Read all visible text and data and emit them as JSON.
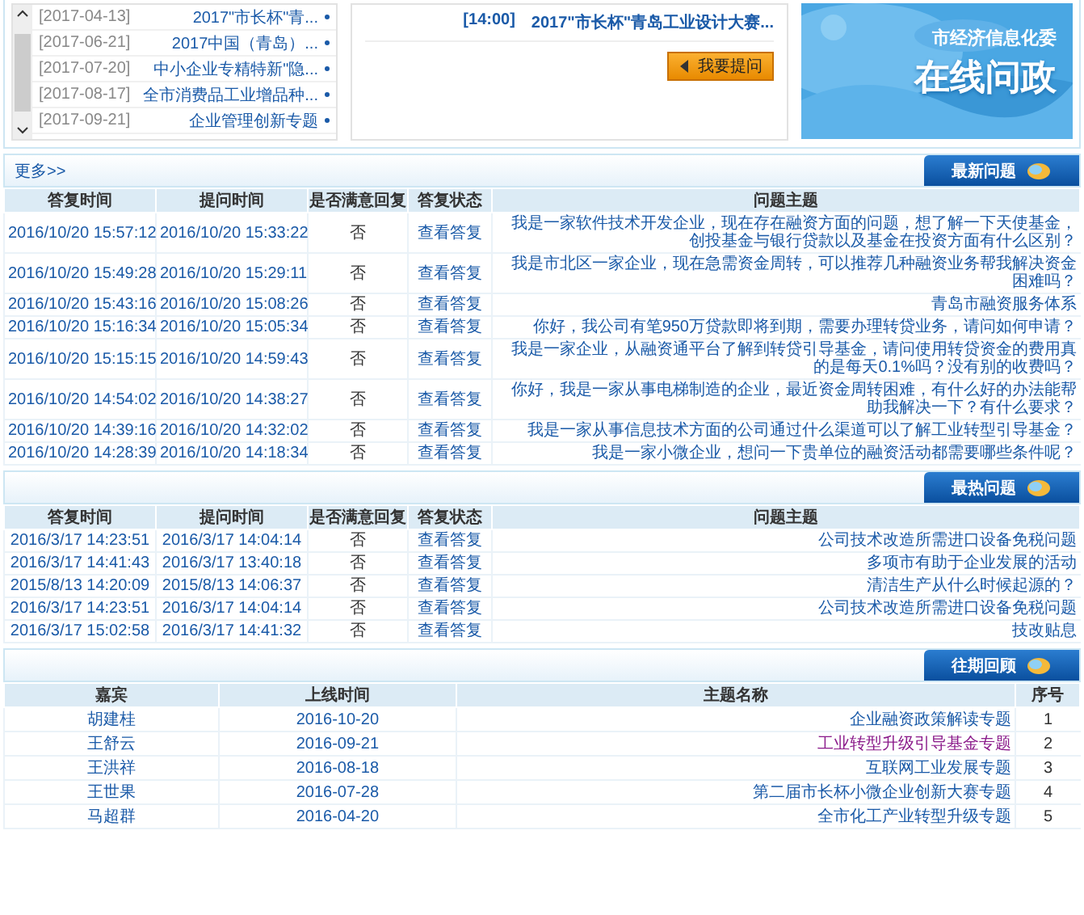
{
  "banner": {
    "subtitle": "市经济信息化委",
    "title": "在线问政"
  },
  "notice": {
    "headline": "2017\"市长杯\"青岛工业设计大赛...",
    "time": "[14:00]",
    "button": "我要提问"
  },
  "topics_list": [
    {
      "title": "2017\"市长杯\"青...",
      "date": "[2017-04-13]"
    },
    {
      "title": "2017中国（青岛）...",
      "date": "[2017-06-21]"
    },
    {
      "title": "中小企业专精特新\"隐...",
      "date": "[2017-07-20]"
    },
    {
      "title": "全市消费品工业增品种...",
      "date": "[2017-08-17]"
    },
    {
      "title": "企业管理创新专题",
      "date": "[2017-09-21]"
    }
  ],
  "latest": {
    "title": "最新问题",
    "more": "更多>>",
    "columns": [
      "答复时间",
      "提问时间",
      "是否满意回复",
      "答复状态",
      "问题主题"
    ],
    "rows": [
      {
        "question": "我是一家软件技术开发企业，现在存在融资方面的问题，想了解一下天使基金，创投基金与银行贷款以及基金在投资方面有什么区别？",
        "status": "查看答复",
        "satisfied": "否",
        "asked": "2016/10/20 15:33:22",
        "answered": "2016/10/20 15:57:12"
      },
      {
        "question": "我是市北区一家企业，现在急需资金周转，可以推荐几种融资业务帮我解决资金困难吗？",
        "status": "查看答复",
        "satisfied": "否",
        "asked": "2016/10/20 15:29:11",
        "answered": "2016/10/20 15:49:28"
      },
      {
        "question": "青岛市融资服务体系",
        "status": "查看答复",
        "satisfied": "否",
        "asked": "2016/10/20 15:08:26",
        "answered": "2016/10/20 15:43:16"
      },
      {
        "question": "你好，我公司有笔950万贷款即将到期，需要办理转贷业务，请问如何申请？",
        "status": "查看答复",
        "satisfied": "否",
        "asked": "2016/10/20 15:05:34",
        "answered": "2016/10/20 15:16:34"
      },
      {
        "question": "我是一家企业，从融资通平台了解到转贷引导基金，请问使用转贷资金的费用真的是每天0.1%吗？没有别的收费吗？",
        "status": "查看答复",
        "satisfied": "否",
        "asked": "2016/10/20 14:59:43",
        "answered": "2016/10/20 15:15:15"
      },
      {
        "question": "你好，我是一家从事电梯制造的企业，最近资金周转困难，有什么好的办法能帮助我解决一下？有什么要求？",
        "status": "查看答复",
        "satisfied": "否",
        "asked": "2016/10/20 14:38:27",
        "answered": "2016/10/20 14:54:02"
      },
      {
        "question": "我是一家从事信息技术方面的公司通过什么渠道可以了解工业转型引导基金？",
        "status": "查看答复",
        "satisfied": "否",
        "asked": "2016/10/20 14:32:02",
        "answered": "2016/10/20 14:39:16"
      },
      {
        "question": "我是一家小微企业，想问一下贵单位的融资活动都需要哪些条件呢？",
        "status": "查看答复",
        "satisfied": "否",
        "asked": "2016/10/20 14:18:34",
        "answered": "2016/10/20 14:28:39"
      }
    ]
  },
  "hot": {
    "title": "最热问题",
    "columns": [
      "答复时间",
      "提问时间",
      "是否满意回复",
      "答复状态",
      "问题主题"
    ],
    "rows": [
      {
        "question": "公司技术改造所需进口设备免税问题",
        "status": "查看答复",
        "satisfied": "否",
        "asked": "2016/3/17 14:04:14",
        "answered": "2016/3/17 14:23:51"
      },
      {
        "question": "多项市有助于企业发展的活动",
        "status": "查看答复",
        "satisfied": "否",
        "asked": "2016/3/17 13:40:18",
        "answered": "2016/3/17 14:41:43"
      },
      {
        "question": "清洁生产从什么时候起源的？",
        "status": "查看答复",
        "satisfied": "否",
        "asked": "2015/8/13 14:06:37",
        "answered": "2015/8/13 14:20:09"
      },
      {
        "question": "公司技术改造所需进口设备免税问题",
        "status": "查看答复",
        "satisfied": "否",
        "asked": "2016/3/17 14:04:14",
        "answered": "2016/3/17 14:23:51"
      },
      {
        "question": "技改贴息",
        "status": "查看答复",
        "satisfied": "否",
        "asked": "2016/3/17 14:41:32",
        "answered": "2016/3/17 15:02:58"
      }
    ]
  },
  "past": {
    "title": "往期回顾",
    "columns": [
      "嘉宾",
      "上线时间",
      "主题名称",
      "序号"
    ],
    "rows": [
      {
        "no": "1",
        "topic": "企业融资政策解读专题",
        "date": "2016-10-20",
        "guest": "胡建桂",
        "visited": false
      },
      {
        "no": "2",
        "topic": "工业转型升级引导基金专题",
        "date": "2016-09-21",
        "guest": "王舒云",
        "visited": true
      },
      {
        "no": "3",
        "topic": "互联网工业发展专题",
        "date": "2016-08-18",
        "guest": "王洪祥",
        "visited": false
      },
      {
        "no": "4",
        "topic": "第二届市长杯小微企业创新大赛专题",
        "date": "2016-07-28",
        "guest": "王世果",
        "visited": false
      },
      {
        "no": "5",
        "topic": "全市化工产业转型升级专题",
        "date": "2016-04-20",
        "guest": "马超群",
        "visited": false
      }
    ]
  }
}
